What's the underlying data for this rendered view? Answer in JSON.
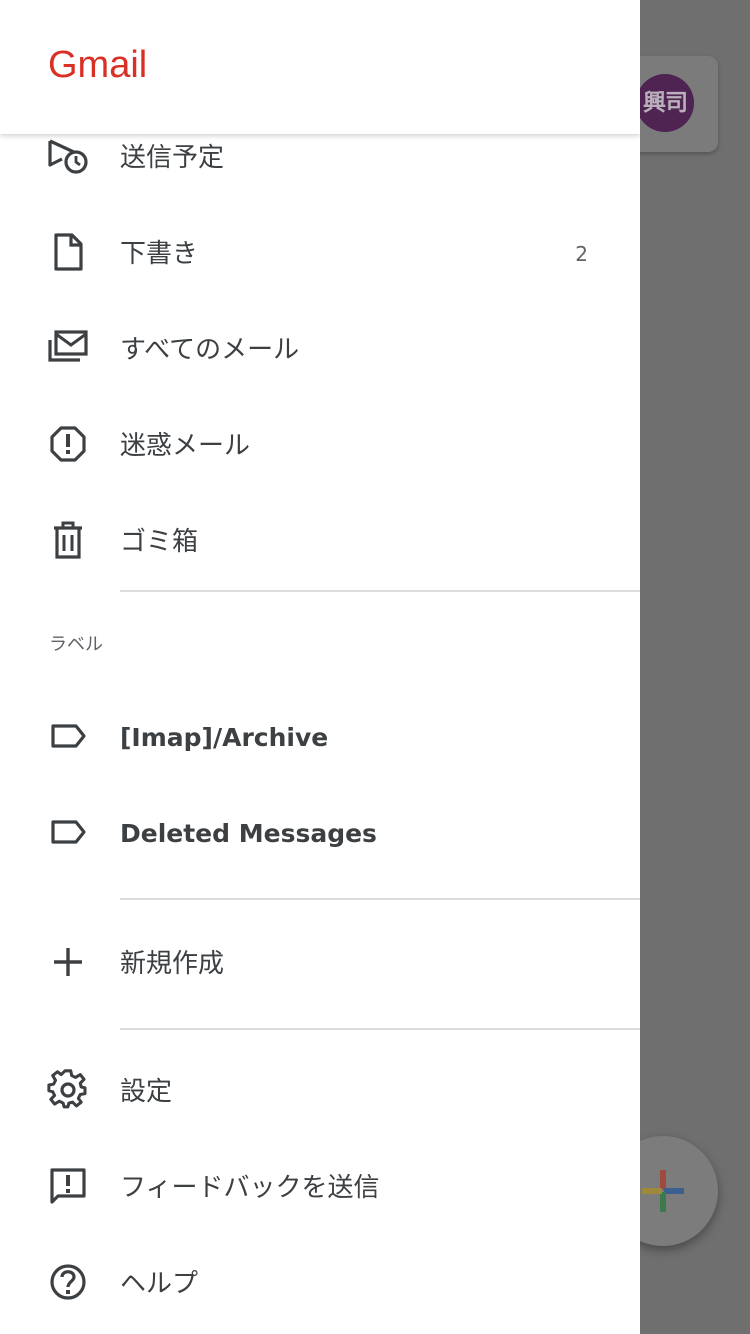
{
  "app": {
    "logo": "Gmail"
  },
  "background": {
    "avatar_text": "興司",
    "fab_colors": [
      "#ea4335",
      "#4285f4",
      "#34a853",
      "#fbbc04"
    ]
  },
  "nav": {
    "scheduled": {
      "label": "送信予定",
      "icon": "scheduled-send-icon"
    },
    "drafts": {
      "label": "下書き",
      "count": "2",
      "icon": "draft-icon"
    },
    "all_mail": {
      "label": "すべてのメール",
      "icon": "all-mail-icon"
    },
    "spam": {
      "label": "迷惑メール",
      "icon": "spam-icon"
    },
    "trash": {
      "label": "ゴミ箱",
      "icon": "trash-icon"
    }
  },
  "labels": {
    "header": "ラベル",
    "items": [
      {
        "label": "[Imap]/Archive",
        "icon": "label-icon"
      },
      {
        "label": "Deleted Messages",
        "icon": "label-icon"
      }
    ],
    "create": {
      "label": "新規作成",
      "icon": "plus-icon"
    }
  },
  "footer": {
    "settings": {
      "label": "設定",
      "icon": "gear-icon"
    },
    "feedback": {
      "label": "フィードバックを送信",
      "icon": "feedback-icon"
    },
    "help": {
      "label": "ヘルプ",
      "icon": "help-icon"
    }
  },
  "colors": {
    "logo": "#d93025",
    "text": "#3c4043",
    "icon": "#3c4043",
    "scrim": "#6f6f6f"
  }
}
